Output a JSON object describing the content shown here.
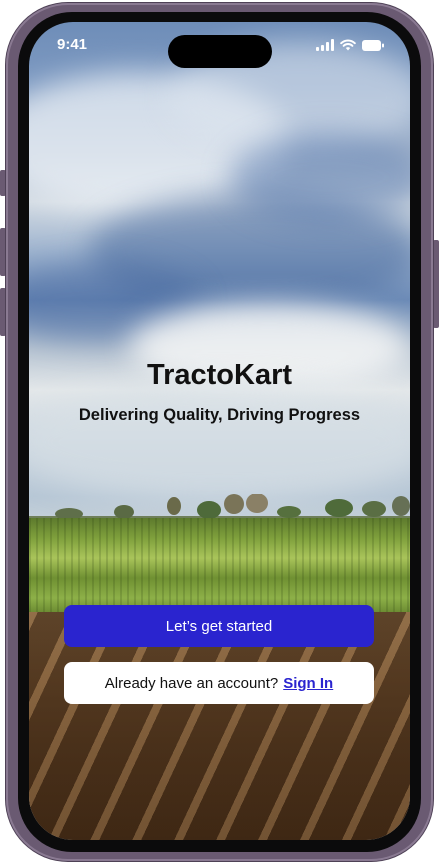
{
  "status_bar": {
    "time": "9:41"
  },
  "icons": {
    "signal": "cellular-signal-icon",
    "wifi": "wifi-icon",
    "battery": "battery-icon"
  },
  "hero": {
    "title": "TractoKart",
    "subtitle": "Delivering Quality, Driving Progress"
  },
  "actions": {
    "get_started_label": "Let’s get started",
    "signin_prompt": "Already have an account?",
    "signin_link": "Sign In"
  },
  "colors": {
    "primary": "#2a24cf",
    "frame": "#6a5a72"
  }
}
